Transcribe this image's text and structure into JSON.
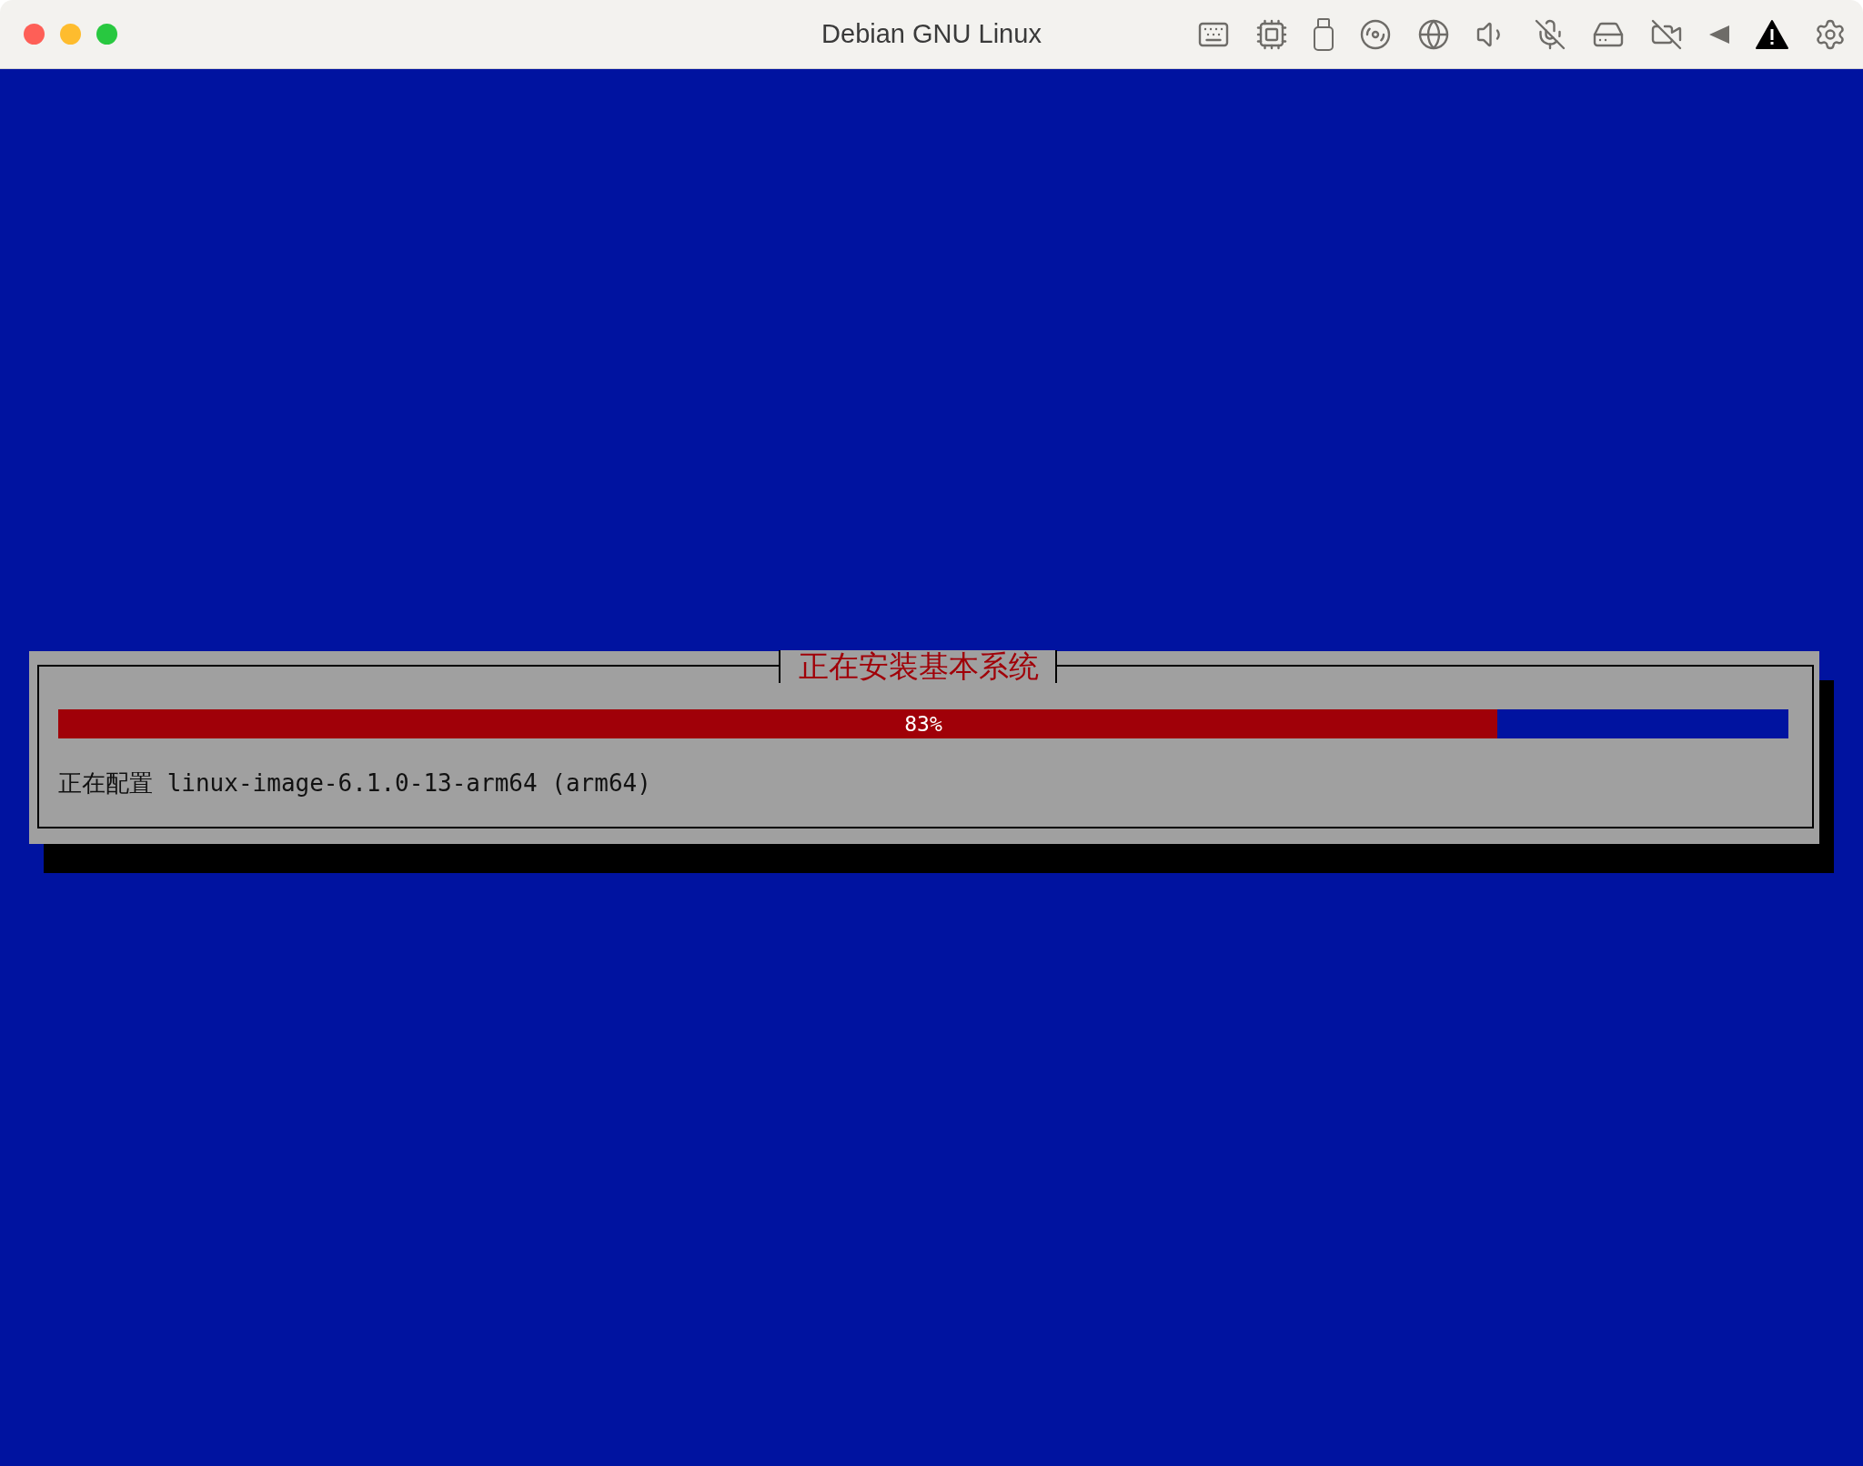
{
  "window": {
    "title": "Debian GNU Linux"
  },
  "dialog": {
    "title": "正在安装基本系统",
    "progress": {
      "level": 0.832,
      "reading": "83%"
    },
    "status": "正在配置 linux-image-6.1.0-13-arm64 (arm64)"
  }
}
